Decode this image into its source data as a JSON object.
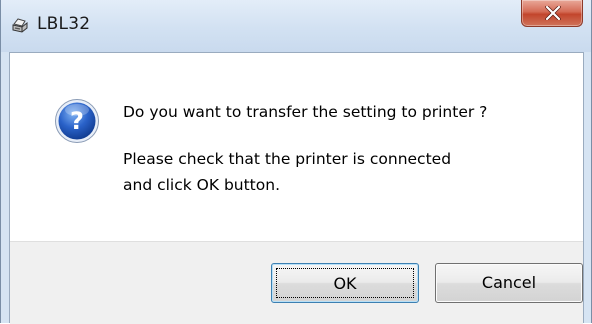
{
  "window": {
    "title": "LBL32",
    "app_icon": "printer-app-icon",
    "close_icon": "close-icon"
  },
  "message": {
    "icon": "question-icon",
    "question": "Do you want to transfer the setting to printer ?",
    "instruction_line1": "Please check that the printer is connected",
    "instruction_line2": "and click OK button."
  },
  "buttons": {
    "ok_label": "OK",
    "cancel_label": "Cancel"
  },
  "colors": {
    "titlebar": "#d2e1f2",
    "close_button": "#c2452c",
    "question_icon": "#2a62c9",
    "button_area": "#f0f0f0",
    "default_button_border": "#3c7fb1"
  }
}
